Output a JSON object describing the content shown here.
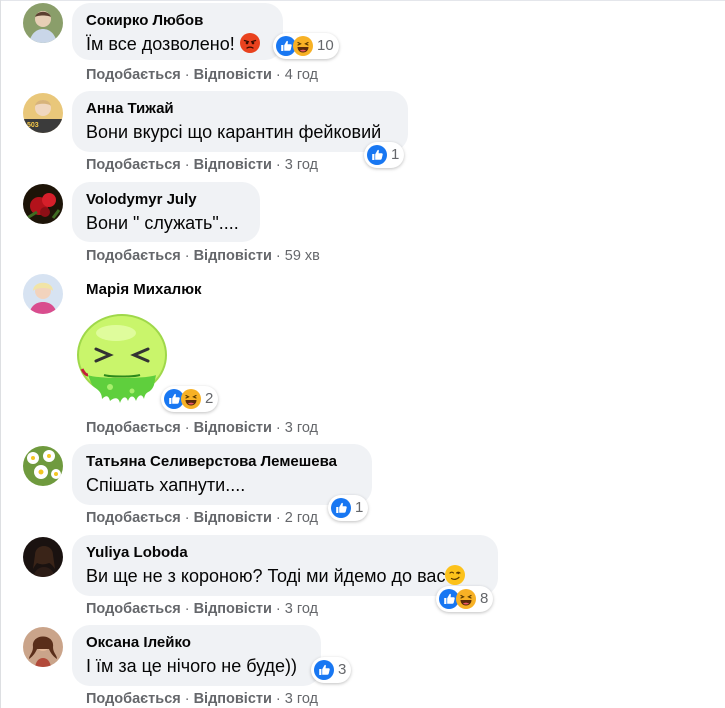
{
  "comments": [
    {
      "author": "Сокирко Любов",
      "text": "Їм все дозволено!",
      "like_label": "Подобається",
      "reply_label": "Відповісти",
      "time": "4 год",
      "reactions": [
        "like-icon",
        "haha-icon"
      ],
      "reaction_count": "10",
      "text_emoji": "angry-emoji-icon"
    },
    {
      "author": "Анна Тижай",
      "text": "Вони вкурсі що карантин фейковий",
      "like_label": "Подобається",
      "reply_label": "Відповісти",
      "time": "3 год",
      "reactions": [
        "like-icon"
      ],
      "reaction_count": "1"
    },
    {
      "author": "Volodymyr July",
      "text": "Вони \" служать\"....",
      "like_label": "Подобається",
      "reply_label": "Відповісти",
      "time": "59 хв"
    },
    {
      "author": "Марія Михалюк",
      "sticker": "vomiting-face-sticker",
      "like_label": "Подобається",
      "reply_label": "Відповісти",
      "time": "3 год",
      "reactions": [
        "like-icon",
        "haha-icon"
      ],
      "reaction_count": "2"
    },
    {
      "author": "Татьяна Селиверстова Лемешева",
      "text": "Спішать хапнути....",
      "like_label": "Подобається",
      "reply_label": "Відповісти",
      "time": "2 год",
      "reactions": [
        "like-icon"
      ],
      "reaction_count": "1"
    },
    {
      "author": "Yuliya Loboda",
      "text": "Ви ще не з короною? Тоді ми йдемо до вас",
      "like_label": "Подобається",
      "reply_label": "Відповісти",
      "time": "3 год",
      "reactions": [
        "like-icon",
        "haha-icon"
      ],
      "reaction_count": "8",
      "text_emoji": "smirk-emoji-icon"
    },
    {
      "author": "Оксана Ілейко",
      "text": "І їм за це нічого не буде))",
      "like_label": "Подобається",
      "reply_label": "Відповісти",
      "time": "3 год",
      "reactions": [
        "like-icon"
      ],
      "reaction_count": "3"
    }
  ],
  "colors": {
    "bubble": "#f0f2f5",
    "like_blue": "#1877f2",
    "meta_gray": "#65676b",
    "haha_yellow": "#f7b125"
  }
}
